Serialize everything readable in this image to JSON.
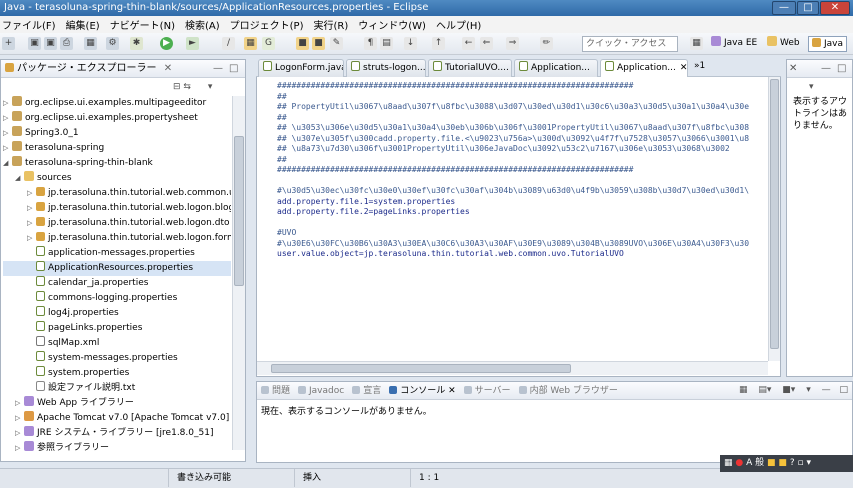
{
  "window": {
    "title": "Java - terasoluna-spring-thin-blank/sources/ApplicationResources.properties - Eclipse"
  },
  "menu": [
    "ファイル(F)",
    "編集(E)",
    "ナビゲート(N)",
    "検索(A)",
    "プロジェクト(P)",
    "実行(R)",
    "ウィンドウ(W)",
    "ヘルプ(H)"
  ],
  "toolbar": {
    "quick_access_placeholder": "クイック・アクセス",
    "perspectives": [
      "Java EE",
      "Web",
      "Java"
    ]
  },
  "package_explorer": {
    "title": "パッケージ・エクスプローラー",
    "items": [
      {
        "label": "org.eclipse.ui.examples.multipageeditor",
        "indent": 0,
        "expanded": false,
        "icon": "project"
      },
      {
        "label": "org.eclipse.ui.examples.propertysheet",
        "indent": 0,
        "expanded": false,
        "icon": "project"
      },
      {
        "label": "Spring3.0_1",
        "indent": 0,
        "expanded": false,
        "icon": "project"
      },
      {
        "label": "terasoluna-spring",
        "indent": 0,
        "expanded": false,
        "icon": "project"
      },
      {
        "label": "terasoluna-spring-thin-blank",
        "indent": 0,
        "expanded": true,
        "icon": "project"
      },
      {
        "label": "sources",
        "indent": 1,
        "expanded": true,
        "icon": "folder"
      },
      {
        "label": "jp.terasoluna.thin.tutorial.web.common.uvo",
        "indent": 2,
        "expanded": false,
        "icon": "package"
      },
      {
        "label": "jp.terasoluna.thin.tutorial.web.logon.blogic",
        "indent": 2,
        "expanded": false,
        "icon": "package"
      },
      {
        "label": "jp.terasoluna.thin.tutorial.web.logon.dto",
        "indent": 2,
        "expanded": false,
        "icon": "package"
      },
      {
        "label": "jp.terasoluna.thin.tutorial.web.logon.form",
        "indent": 2,
        "expanded": false,
        "icon": "package"
      },
      {
        "label": "application-messages.properties",
        "indent": 2,
        "icon": "file"
      },
      {
        "label": "ApplicationResources.properties",
        "indent": 2,
        "icon": "file",
        "selected": true
      },
      {
        "label": "calendar_ja.properties",
        "indent": 2,
        "icon": "file"
      },
      {
        "label": "commons-logging.properties",
        "indent": 2,
        "icon": "file"
      },
      {
        "label": "log4j.properties",
        "indent": 2,
        "icon": "file"
      },
      {
        "label": "pageLinks.properties",
        "indent": 2,
        "icon": "file"
      },
      {
        "label": "sqlMap.xml",
        "indent": 2,
        "icon": "xml"
      },
      {
        "label": "system-messages.properties",
        "indent": 2,
        "icon": "file"
      },
      {
        "label": "system.properties",
        "indent": 2,
        "icon": "file"
      },
      {
        "label": "設定ファイル説明.txt",
        "indent": 2,
        "icon": "txt"
      },
      {
        "label": "Web App ライブラリー",
        "indent": 1,
        "expanded": false,
        "icon": "lib"
      },
      {
        "label": "Apache Tomcat v7.0 [Apache Tomcat v7.0]",
        "indent": 1,
        "expanded": false,
        "icon": "server"
      },
      {
        "label": "JRE システム・ライブラリー [jre1.8.0_51]",
        "indent": 1,
        "expanded": false,
        "icon": "lib"
      },
      {
        "label": "参照ライブラリー",
        "indent": 1,
        "expanded": false,
        "icon": "lib"
      }
    ]
  },
  "editor": {
    "tabs": [
      {
        "label": "LogonForm.java",
        "active": false
      },
      {
        "label": "struts-logon...",
        "active": false
      },
      {
        "label": "TutorialUVO....",
        "active": false
      },
      {
        "label": "Application...",
        "active": false
      },
      {
        "label": "Application...",
        "active": true
      }
    ],
    "overflow": "»1",
    "lines": [
      "##########################################################################",
      "##",
      "## PropertyUtil\\u3067\\u8aad\\u307f\\u8fbc\\u3088\\u3d07\\u30ed\\u30d1\\u30c6\\u30a3\\u30d5\\u30a1\\u30a4\\u30e",
      "##",
      "## \\u3053\\u306e\\u30d5\\u30a1\\u30a4\\u30eb\\u306b\\u306f\\u3001PropertyUtil\\u3067\\u8aad\\u307f\\u8fbc\\u308",
      "## \\u307e\\u305f\\u300cadd.property.file.<\\u9023\\u756a>\\u300d\\u3092\\u4f7f\\u7528\\u3057\\u3066\\u3001\\u8",
      "## \\u8a73\\u7d30\\u306f\\u3001PropertyUtil\\u306eJavaDoc\\u3092\\u53c2\\u7167\\u306e\\u3053\\u3068\\u3002",
      "##",
      "##########################################################################",
      "",
      "#\\u30d5\\u30ec\\u30fc\\u30e0\\u30ef\\u30fc\\u30af\\u304b\\u3089\\u63d0\\u4f9b\\u3059\\u308b\\u30d7\\u30ed\\u30d1\\",
      "add.property.file.1=system.properties",
      "add.property.file.2=pageLinks.properties",
      "",
      "#UVO",
      "#\\u30E6\\u30FC\\u30B6\\u30A3\\u30EA\\u30C6\\u30A3\\u30AF\\u30E9\\u3089\\u304B\\u3089UVO\\u306E\\u30A4\\u30F3\\u30",
      "user.value.object=jp.terasoluna.thin.tutorial.web.common.uvo.TutorialUVO"
    ]
  },
  "outline": {
    "message": "表示するアウトラインはありません。"
  },
  "console": {
    "tabs": [
      "問題",
      "Javadoc",
      "宣言",
      "コンソール",
      "サーバー",
      "内部 Web ブラウザー"
    ],
    "message": "現在、表示するコンソールがありません。"
  },
  "statusbar": {
    "mode": "書き込み可能",
    "insert": "挿入",
    "position": "1 : 1"
  },
  "tray": {
    "ime": "A 般"
  }
}
